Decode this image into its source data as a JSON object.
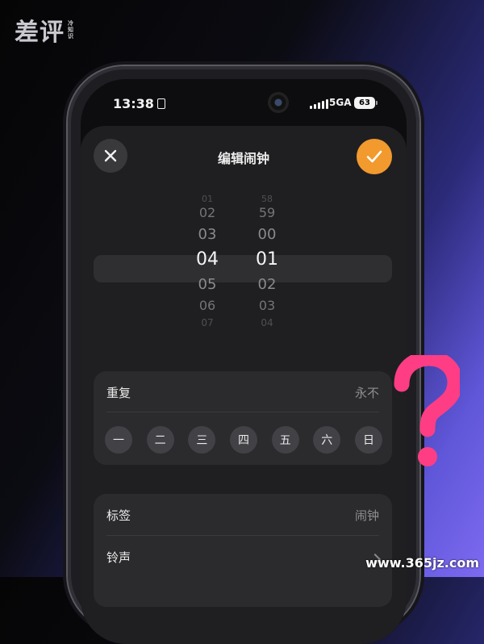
{
  "logo": {
    "main": "差评",
    "sub": [
      "冷",
      "知",
      "识"
    ]
  },
  "status_bar": {
    "time": "13:38",
    "network": "5GA",
    "battery": "63"
  },
  "alarm_editor": {
    "title": "编辑闹钟",
    "hour_wheel": [
      "01",
      "02",
      "03",
      "04",
      "05",
      "06",
      "07"
    ],
    "minute_wheel": [
      "58",
      "59",
      "00",
      "01",
      "02",
      "03",
      "04"
    ],
    "selected_hour": "04",
    "selected_minute": "01"
  },
  "repeat": {
    "label": "重复",
    "value": "永不",
    "days": [
      "一",
      "二",
      "三",
      "四",
      "五",
      "六",
      "日"
    ]
  },
  "settings": {
    "label_row": {
      "label": "标签",
      "value": "闹钟"
    },
    "ringtone_row": {
      "label": "铃声"
    }
  },
  "overlay": {
    "mark": "?",
    "mark_color": "#ff3d84"
  },
  "watermark": "www.365jz.com",
  "colors": {
    "accent": "#f29a2e",
    "sheet": "#1f1f21",
    "card": "#2b2b2e"
  }
}
